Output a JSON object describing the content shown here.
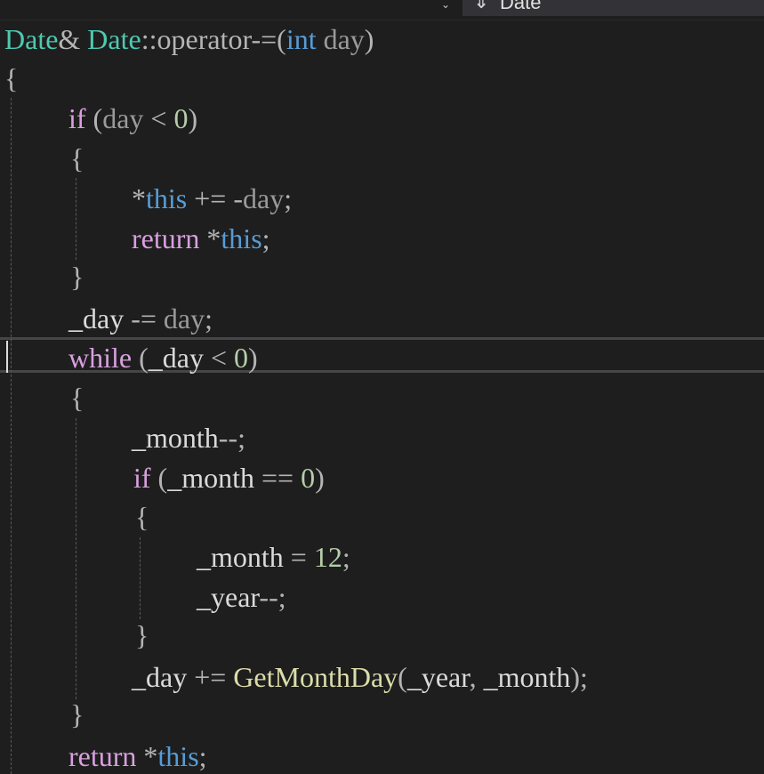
{
  "toolbar": {
    "chevron": "⌄",
    "nav_icon": "⇓",
    "nav_label": "Date"
  },
  "code": {
    "l1_type1": "Date",
    "l1_amp": "&",
    "l1_type2": "Date",
    "l1_op": "::operator-=(",
    "l1_int": "int",
    "l1_param": "day",
    "l1_close": ")",
    "l2": "{",
    "l3_if": "if",
    "l3_open": " (",
    "l3_param": "day",
    "l3_lt": " < ",
    "l3_zero": "0",
    "l3_close": ")",
    "l4": "{",
    "l5_star": "*",
    "l5_this": "this",
    "l5_op": " += -",
    "l5_param": "day",
    "l5_semi": ";",
    "l6_return": "return",
    "l6_star": " *",
    "l6_this": "this",
    "l6_semi": ";",
    "l7": "}",
    "l8_member": "_day",
    "l8_op": " -= ",
    "l8_param": "day",
    "l8_semi": ";",
    "l9_while": "while",
    "l9_open": " (",
    "l9_member": "_day",
    "l9_lt": " < ",
    "l9_zero": "0",
    "l9_close": ")",
    "l10": "{",
    "l11_member": "_month",
    "l11_op": "--;",
    "l12_if": "if",
    "l12_open": " (",
    "l12_member": "_month",
    "l12_eq": " == ",
    "l12_zero": "0",
    "l12_close": ")",
    "l13": "{",
    "l14_member": "_month",
    "l14_op": " = ",
    "l14_num": "12",
    "l14_semi": ";",
    "l15_member": "_year",
    "l15_op": "--;",
    "l16": "}",
    "l17_member": "_day",
    "l17_op": " += ",
    "l17_fn": "GetMonthDay",
    "l17_open": "(",
    "l17_arg1": "_year",
    "l17_comma": ", ",
    "l17_arg2": "_month",
    "l17_close": ");",
    "l18": "}",
    "l19_return": "return",
    "l19_star": " *",
    "l19_this": "this",
    "l19_semi": ";"
  },
  "colors": {
    "background": "#1e1e1e",
    "control_keyword": "#d8a0df",
    "keyword": "#569cd6",
    "type": "#4ec9b0",
    "function": "#dcdcaa",
    "number": "#b5cea8",
    "parameter": "#9a9a9a"
  }
}
